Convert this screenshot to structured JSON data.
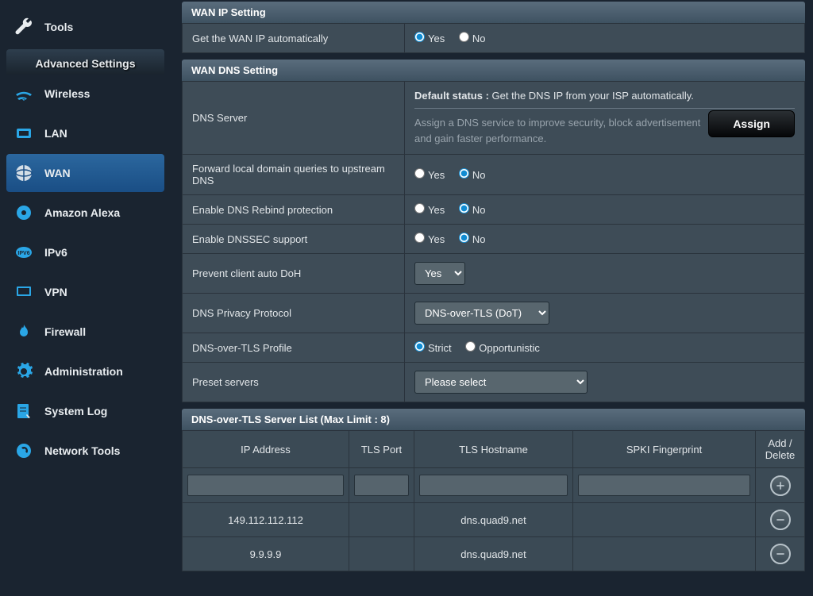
{
  "sidebar": {
    "tools": "Tools",
    "section": "Advanced Settings",
    "items": [
      {
        "label": "Wireless"
      },
      {
        "label": "LAN"
      },
      {
        "label": "WAN"
      },
      {
        "label": "Amazon Alexa"
      },
      {
        "label": "IPv6"
      },
      {
        "label": "VPN"
      },
      {
        "label": "Firewall"
      },
      {
        "label": "Administration"
      },
      {
        "label": "System Log"
      },
      {
        "label": "Network Tools"
      }
    ]
  },
  "wan_ip": {
    "title": "WAN IP Setting",
    "auto_label": "Get the WAN IP automatically",
    "yes": "Yes",
    "no": "No"
  },
  "wan_dns": {
    "title": "WAN DNS Setting",
    "server_label": "DNS Server",
    "default_status_key": "Default status :",
    "default_status_val": "Get the DNS IP from your ISP automatically.",
    "service_desc": "Assign a DNS service to improve security, block advertisement and gain faster performance.",
    "assign": "Assign",
    "fwd_label": "Forward local domain queries to upstream DNS",
    "rebind_label": "Enable DNS Rebind protection",
    "dnssec_label": "Enable DNSSEC support",
    "doh_label": "Prevent client auto DoH",
    "doh_value": "Yes",
    "privacy_label": "DNS Privacy Protocol",
    "privacy_value": "DNS-over-TLS (DoT)",
    "profile_label": "DNS-over-TLS Profile",
    "strict": "Strict",
    "opp": "Opportunistic",
    "preset_label": "Preset servers",
    "preset_value": "Please select",
    "yes": "Yes",
    "no": "No"
  },
  "dot_list": {
    "title": "DNS-over-TLS Server List (Max Limit : 8)",
    "cols": {
      "ip": "IP Address",
      "port": "TLS Port",
      "host": "TLS Hostname",
      "spki": "SPKI Fingerprint",
      "action": "Add / Delete"
    },
    "rows": [
      {
        "ip": "149.112.112.112",
        "port": "",
        "host": "dns.quad9.net",
        "spki": ""
      },
      {
        "ip": "9.9.9.9",
        "port": "",
        "host": "dns.quad9.net",
        "spki": ""
      }
    ]
  }
}
